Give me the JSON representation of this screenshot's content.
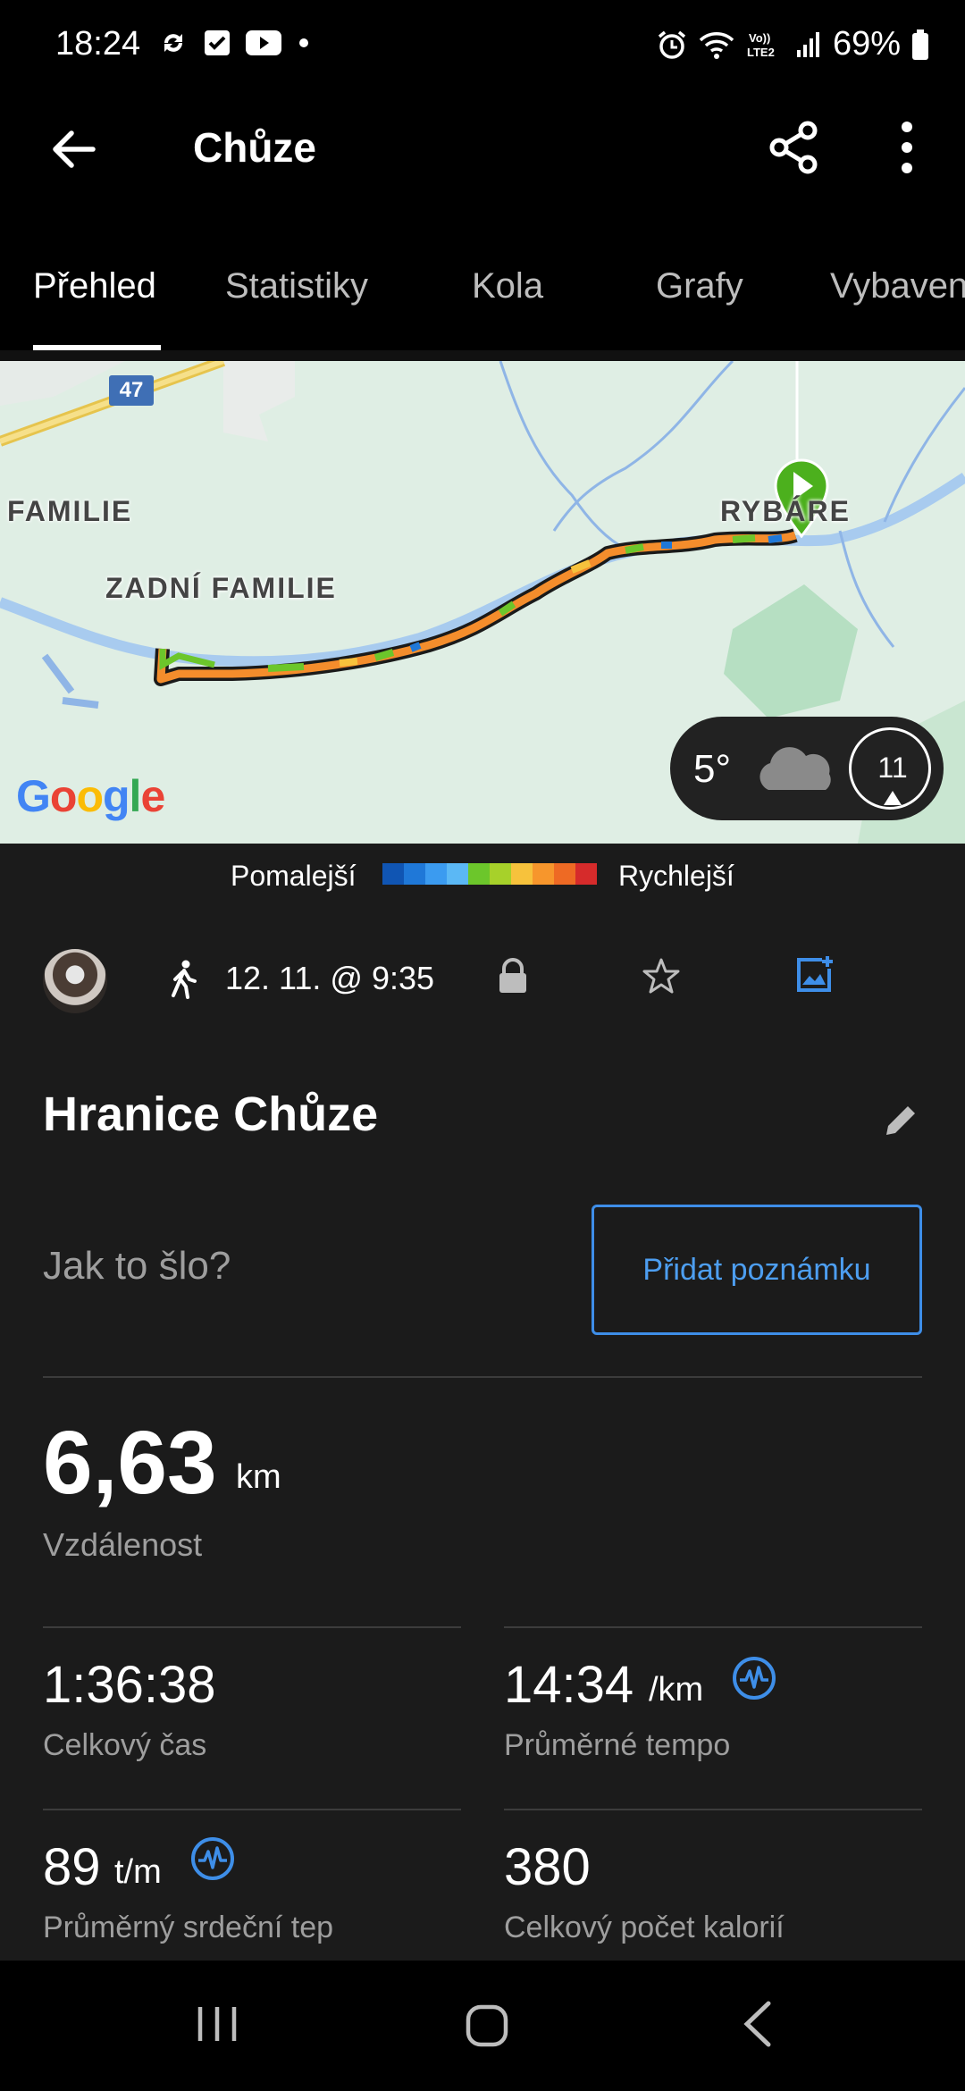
{
  "status_bar": {
    "time": "18:24",
    "battery": "69%",
    "network": "Vo) LTE2"
  },
  "app_bar": {
    "title": "Chůze"
  },
  "tabs": [
    {
      "label": "Přehled",
      "active": true
    },
    {
      "label": "Statistiky",
      "active": false
    },
    {
      "label": "Kola",
      "active": false
    },
    {
      "label": "Grafy",
      "active": false
    },
    {
      "label": "Vybaven",
      "active": false
    }
  ],
  "map": {
    "labels": [
      "FAMILIE",
      "ZADNÍ FAMILIE",
      "RYBÁRE"
    ],
    "road_number": "47",
    "attribution": "Google",
    "weather": {
      "temperature": "5°",
      "wind": "11"
    }
  },
  "speed_legend": {
    "slow": "Pomalejší",
    "fast": "Rychlejší",
    "colors": [
      "#1055b3",
      "#1f78d8",
      "#3b9bf0",
      "#5bb8f5",
      "#6cc62b",
      "#a7d12a",
      "#f7c23c",
      "#f7962c",
      "#ee6a24",
      "#d62b2b"
    ]
  },
  "activity": {
    "date": "12. 11. @ 9:35",
    "name": "Hranice Chůze",
    "prompt": "Jak to šlo?",
    "add_note": "Přidat poznámku"
  },
  "stats": {
    "distance": {
      "value": "6,63",
      "unit": "km",
      "label": "Vzdálenost"
    },
    "total_time": {
      "value": "1:36:38",
      "label": "Celkový čas"
    },
    "avg_pace": {
      "value": "14:34",
      "unit": "/km",
      "label": "Průměrné tempo"
    },
    "avg_hr": {
      "value": "89",
      "unit": "t/m",
      "label": "Průměrný srdeční tep"
    },
    "calories": {
      "value": "380",
      "label": "Celkový počet kalorií"
    }
  },
  "colors": {
    "accent": "#3e8ee8",
    "background": "#1b1b1b",
    "start_marker": "#4cb01d"
  }
}
